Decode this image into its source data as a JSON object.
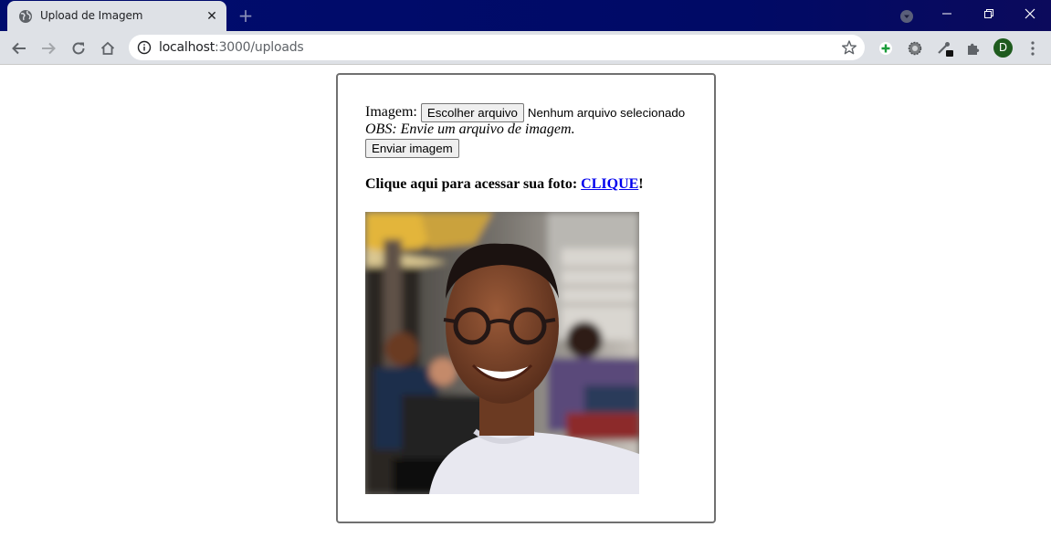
{
  "browser": {
    "tab": {
      "title": "Upload de Imagem",
      "close_glyph": "✕"
    },
    "new_tab_glyph": "+",
    "address": {
      "host": "localhost",
      "path": ":3000/uploads"
    },
    "profile_initial": "D",
    "icons": {
      "favicon": "globe-icon",
      "back": "back-arrow-icon",
      "forward": "forward-arrow-icon",
      "reload": "reload-icon",
      "home": "home-icon",
      "site_info": "info-icon",
      "bookmark": "star-icon",
      "extensions": [
        "plus-extension-icon",
        "gear-extension-icon",
        "eyedropper-extension-icon",
        "puzzle-icon"
      ],
      "menu": "kebab-menu-icon"
    },
    "colors": {
      "titlebar": "#000c6e",
      "toolbar": "#dee1e6",
      "avatar": "#1e5b1e"
    }
  },
  "form": {
    "image_label": "Imagem:",
    "file_button": "Escolher arquivo",
    "file_status": "Nenhum arquivo selecionado",
    "note": "OBS: Envie um arquivo de imagem.",
    "submit_button": "Enviar imagem"
  },
  "access": {
    "text": "Clique aqui para acessar sua foto: ",
    "link": "CLIQUE",
    "suffix": "!"
  },
  "photo": {
    "description": "uploaded-photo"
  }
}
